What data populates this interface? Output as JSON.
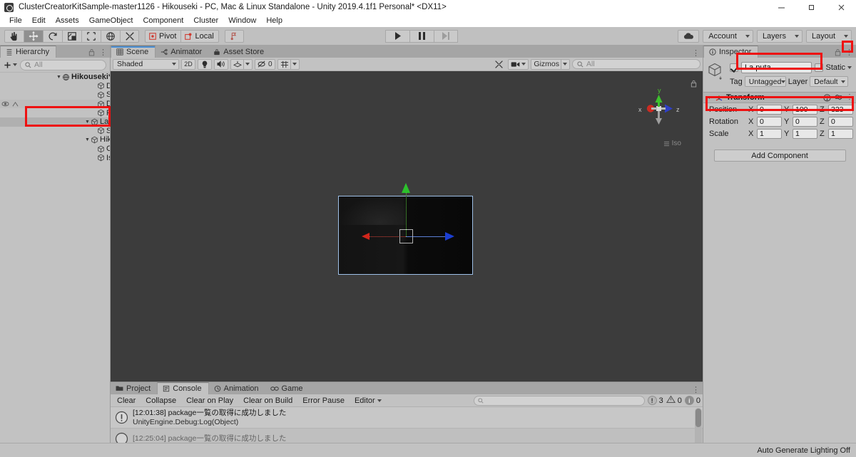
{
  "window": {
    "title": "ClusterCreatorKitSample-master1126 - Hikouseki - PC, Mac & Linux Standalone - Unity 2019.4.1f1 Personal* <DX11>",
    "logo_icon": "unity-logo-icon",
    "minimize_label": "minimize-icon",
    "maximize_label": "maximize-icon",
    "close_label": "close-icon"
  },
  "menubar": {
    "items": [
      {
        "label": "File"
      },
      {
        "label": "Edit"
      },
      {
        "label": "Assets"
      },
      {
        "label": "GameObject"
      },
      {
        "label": "Component"
      },
      {
        "label": "Cluster"
      },
      {
        "label": "Window"
      },
      {
        "label": "Help"
      }
    ]
  },
  "toolbar": {
    "tools": [
      {
        "name": "hand-tool",
        "icon": "hand-icon",
        "active": false
      },
      {
        "name": "move-tool",
        "icon": "move-icon",
        "active": true
      },
      {
        "name": "rotate-tool",
        "icon": "rotate-icon",
        "active": false
      },
      {
        "name": "scale-tool",
        "icon": "scale-icon",
        "active": false
      },
      {
        "name": "rect-tool",
        "icon": "rect-icon",
        "active": false
      },
      {
        "name": "transform-tool",
        "icon": "transform-icon",
        "active": false
      },
      {
        "name": "custom-tool",
        "icon": "wrench-icon",
        "active": false
      }
    ],
    "pivot_label": "Pivot",
    "local_label": "Local",
    "collab_label": "collab-icon",
    "play_label": "play-icon",
    "pause_label": "pause-icon",
    "step_label": "step-icon",
    "cloud_label": "cloud-icon",
    "account_label": "Account",
    "layers_label": "Layers",
    "layout_label": "Layout"
  },
  "hierarchy": {
    "tab_label": "Hierarchy",
    "tab_icon": "hierarchy-icon",
    "create_label": "+",
    "search_placeholder": "All",
    "search_value": "",
    "search_icon": "search-icon",
    "items": [
      {
        "label": "Hikouseki*",
        "depth": 0,
        "expanded": true,
        "icon": "scene-icon",
        "selected": false,
        "bold": true,
        "kebab": true
      },
      {
        "label": "Directional Light",
        "depth": 1,
        "expanded": null,
        "icon": "gameobject-icon",
        "selected": false
      },
      {
        "label": "SpawnPoint",
        "depth": 1,
        "expanded": null,
        "icon": "gameobject-icon",
        "selected": false
      },
      {
        "label": "DespawnHeight",
        "depth": 1,
        "expanded": null,
        "icon": "gameobject-icon",
        "selected": false,
        "hover": true
      },
      {
        "label": "Plane",
        "depth": 1,
        "expanded": null,
        "icon": "gameobject-icon",
        "selected": false
      },
      {
        "label": "La puta",
        "depth": 1,
        "expanded": true,
        "icon": "gameobject-icon",
        "selected": true
      },
      {
        "label": "Shiro",
        "depth": 2,
        "expanded": null,
        "icon": "gameobject-icon",
        "selected": false
      },
      {
        "label": "Hikouseki",
        "depth": 1,
        "expanded": true,
        "icon": "gameobject-icon",
        "selected": false
      },
      {
        "label": "Cylinder",
        "depth": 2,
        "expanded": null,
        "icon": "gameobject-icon",
        "selected": false
      },
      {
        "label": "Ishi",
        "depth": 2,
        "expanded": null,
        "icon": "gameobject-icon",
        "selected": false
      }
    ]
  },
  "scene_panel": {
    "tabs": [
      {
        "label": "Scene",
        "icon": "scene-tab-icon",
        "selected": true
      },
      {
        "label": "Animator",
        "icon": "animator-icon",
        "selected": false
      },
      {
        "label": "Asset Store",
        "icon": "store-icon",
        "selected": false
      }
    ],
    "toolbar": {
      "draw_mode": "Shaded",
      "mode_2d": "2D",
      "lighting_icon": "lightbulb-icon",
      "audio_icon": "speaker-icon",
      "fx_icon": "fx-icon",
      "hidden_count": "0",
      "hidden_icon": "hidden-objects-icon",
      "grid_icon": "grid-snap-icon",
      "component_tools_icon": "wrench-icon",
      "camera_icon": "camera-icon",
      "gizmos_label": "Gizmos",
      "search_placeholder": "All",
      "search_value": "",
      "kebab_icon": "kebab-icon"
    },
    "gizmo": {
      "x_label": "x",
      "y_label": "y",
      "z_label": "z",
      "projection_label": "Iso",
      "lock_icon": "lock-icon"
    }
  },
  "console_panel": {
    "tabs": [
      {
        "label": "Project",
        "icon": "folder-icon",
        "selected": false
      },
      {
        "label": "Console",
        "icon": "console-icon",
        "selected": true
      },
      {
        "label": "Animation",
        "icon": "clock-icon",
        "selected": false
      },
      {
        "label": "Game",
        "icon": "game-icon",
        "selected": false
      }
    ],
    "buttons": [
      {
        "label": "Clear",
        "dropdown": false
      },
      {
        "label": "Collapse",
        "dropdown": false
      },
      {
        "label": "Clear on Play",
        "dropdown": false
      },
      {
        "label": "Clear on Build",
        "dropdown": false
      },
      {
        "label": "Error Pause",
        "dropdown": false
      },
      {
        "label": "Editor",
        "dropdown": true
      }
    ],
    "search_placeholder": "",
    "search_value": "",
    "search_icon": "search-icon",
    "counters": [
      {
        "name": "error-count",
        "icon": "error-icon",
        "value": "3"
      },
      {
        "name": "warning-count",
        "icon": "warning-icon",
        "value": "0"
      },
      {
        "name": "info-count",
        "icon": "info-icon",
        "value": "0"
      }
    ],
    "logs": [
      {
        "icon": "log-info-icon",
        "line1": "[12:01:38] package一覧の取得に成功しました",
        "line2": "UnityEngine.Debug:Log(Object)"
      },
      {
        "icon": "log-info-icon",
        "line1": "[12:25:04] package一覧の取得に成功しました",
        "line2": ""
      }
    ]
  },
  "inspector": {
    "tab_label": "Inspector",
    "tab_icon": "info-icon",
    "lock_icon": "lock-icon",
    "kebab_icon": "kebab-icon",
    "object_icon": "gameobject-icon",
    "enabled": true,
    "name_value": "La puta",
    "static_label": "Static",
    "tag_label": "Tag",
    "tag_value": "Untagged",
    "layer_label": "Layer",
    "layer_value": "Default",
    "transform": {
      "title": "Transform",
      "icon": "transform-icon",
      "help_icon": "help-icon",
      "preset_icon": "preset-icon",
      "kebab_icon": "kebab-icon",
      "rows": [
        {
          "label": "Position",
          "x": "0",
          "y": "100",
          "z": "323"
        },
        {
          "label": "Rotation",
          "x": "0",
          "y": "0",
          "z": "0"
        },
        {
          "label": "Scale",
          "x": "1",
          "y": "1",
          "z": "1"
        }
      ],
      "axis_labels": [
        "X",
        "Y",
        "Z"
      ]
    },
    "add_component_label": "Add Component"
  },
  "statusbar": {
    "text": "Auto Generate Lighting Off"
  },
  "annotations": {
    "color": "#ee1111",
    "boxes": [
      "hierarchy-selection",
      "inspector-name-field",
      "inspector-kebab",
      "transform-position"
    ]
  }
}
